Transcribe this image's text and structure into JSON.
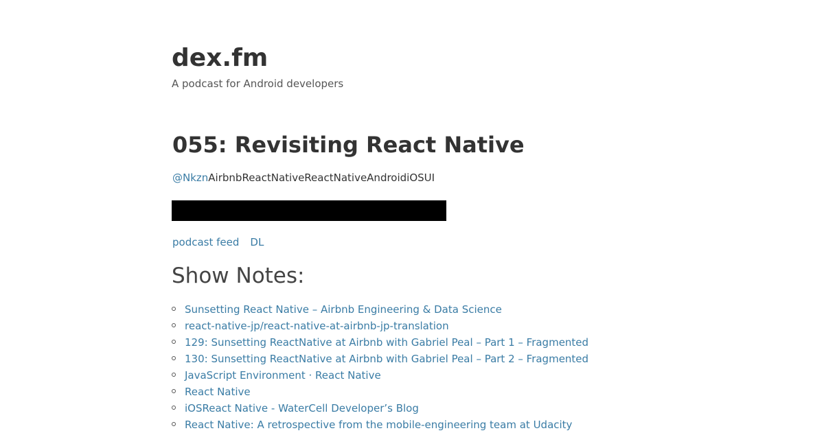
{
  "site": {
    "title": "dex.fm",
    "tagline": "A podcast for Android developers"
  },
  "episode": {
    "title": "055: Revisiting React Native",
    "host_handle": "@Nkzn",
    "description": "AirbnbReactNativeReactNativeAndroidiOSUI"
  },
  "links": {
    "feed": "podcast feed",
    "download": "DL"
  },
  "show_notes": {
    "heading": "Show Notes:",
    "items": [
      "Sunsetting React Native – Airbnb Engineering & Data Science",
      "react-native-jp/react-native-at-airbnb-jp-translation",
      "129: Sunsetting ReactNative at Airbnb with Gabriel Peal – Part 1 – Fragmented",
      "130: Sunsetting ReactNative at Airbnb with Gabriel Peal – Part 2 – Fragmented",
      "JavaScript Environment · React Native",
      "React Native",
      "iOSReact Native - WaterCell Developer’s Blog",
      "React Native: A retrospective from the mobile-engineering team at Udacity"
    ]
  },
  "colors": {
    "link": "#3a7ca5",
    "text": "#333333",
    "player_background": "#000000"
  }
}
